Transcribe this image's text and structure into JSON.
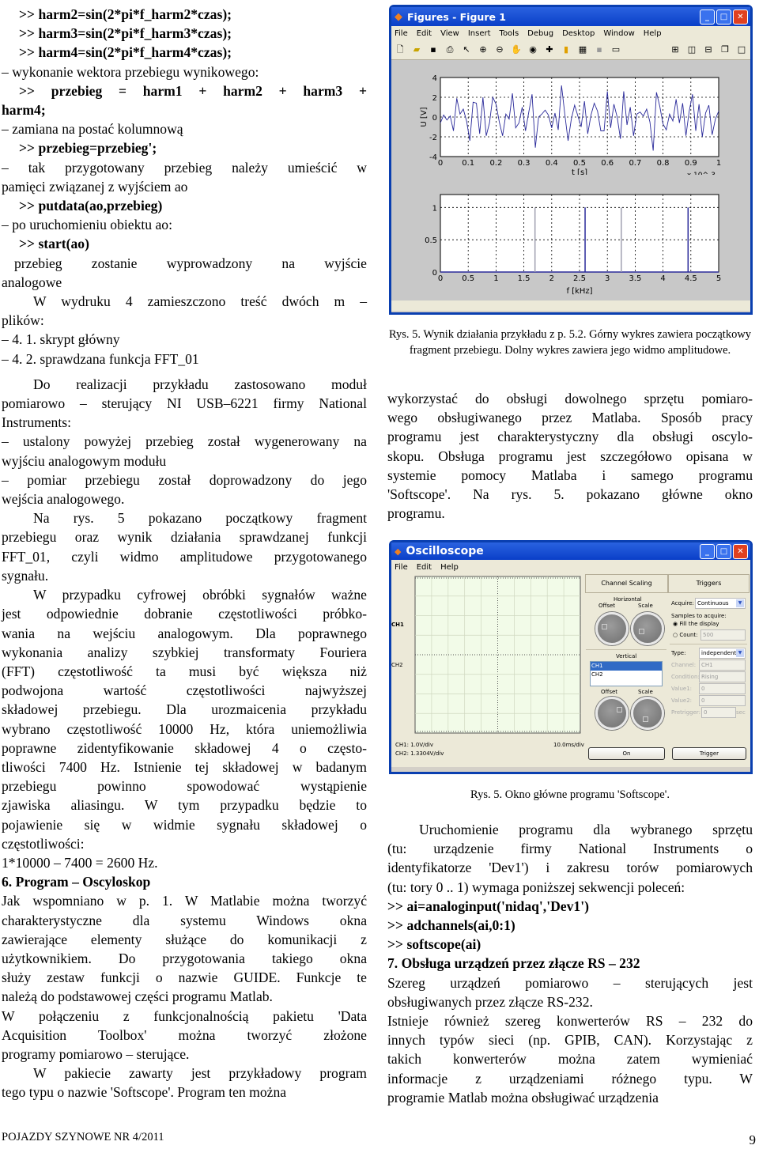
{
  "left_column": {
    "code_lines": [
      ">> harm2=sin(2*pi*f_harm2*czas);",
      ">> harm3=sin(2*pi*f_harm3*czas);",
      ">> harm4=sin(2*pi*f_harm4*czas);"
    ],
    "step_vector": "– wykonanie wektora przebiegu wynikowego:",
    "code_sum_line1": ">>  przebieg  =  harm1  +  harm2  +  harm3  +",
    "code_sum_line2": "harm4;",
    "step_column": "– zamiana na postać kolumnową",
    "code_transpose": ">> przebieg=przebieg';",
    "step_memory_1": "–  tak  przygotowany  przebieg  należy  umieścić  w",
    "step_memory_2": "pamięci związanej z wyjściem ao",
    "code_putdata": ">> putdata(ao,przebieg)",
    "step_start": "– po uruchomieniu obiektu ao:",
    "code_start": ">> start(ao)",
    "result_1": "przebieg  zostanie  wyprowadzony  na  wyjście",
    "result_2": "analogowe",
    "listing_1": "W wydruku 4 zamieszczono treść dwóch m –",
    "listing_2": "plików:",
    "listing_item_1": "– 4. 1. skrypt główny",
    "listing_item_2": "– 4. 2. sprawdzana funkcja FFT_01",
    "para_module": [
      "Do realizacji przykładu zastosowano moduł",
      "pomiarowo – sterujący NI USB–6221 firmy National",
      "Instruments:"
    ],
    "bullet_generated": [
      "– ustalony powyżej przebieg został wygenerowany na",
      "wyjściu analogowym modułu"
    ],
    "bullet_measured": [
      "–  pomiar  przebiegu  został  doprowadzony  do  jego",
      "wejścia analogowego."
    ],
    "para_rys5": [
      "Na rys. 5 pokazano początkowy fragment",
      "przebiegu oraz wynik działania sprawdzanej funkcji",
      "FFT_01, czyli widmo amplitudowe przygotowanego",
      "sygnału."
    ],
    "para_aliasing": [
      "W przypadku cyfrowej obróbki sygnałów ważne",
      "jest odpowiednie dobranie częstotliwości próbko-",
      "wania na wejściu analogowym. Dla poprawnego",
      "wykonania analizy szybkiej transformaty Fouriera",
      "(FFT) częstotliwość ta musi być większa niż",
      "podwojona wartość częstotliwości najwyższej",
      "składowej przebiegu. Dla urozmaicenia przykładu",
      "wybrano częstotliwość 10000 Hz, która uniemożliwia",
      "poprawne zidentyfikowanie składowej 4 o często-",
      "tliwości 7400 Hz. Istnienie tej składowej w badanym",
      "przebiegu powinno spowodować wystąpienie",
      "zjawiska aliasingu. W tym przypadku będzie to",
      "pojawienie się w widmie sygnału składowej o",
      "częstotliwości:"
    ],
    "formula": "1*10000 – 7400 = 2600 Hz.",
    "section_6_heading": "6. Program – Oscyloskop",
    "para_guide": [
      "Jak wspomniano w p. 1. W Matlabie można tworzyć",
      "charakterystyczne dla systemu Windows okna",
      "zawierające elementy służące do komunikacji z",
      "użytkownikiem. Do przygotowania takiego okna",
      "służy zestaw funkcji o nazwie GUIDE. Funkcje te",
      "należą do podstawowej części programu Matlab."
    ],
    "para_daq": [
      "W połączeniu z funkcjonalnością pakietu 'Data",
      "Acquisition Toolbox' można tworzyć złożone",
      "programy pomiarowo – sterujące."
    ],
    "para_softscope": [
      "W pakiecie zawarty jest przykładowy program",
      "tego typu o nazwie 'Softscope'. Program ten można"
    ]
  },
  "figure_window": {
    "title": "Figures - Figure 1",
    "menu": [
      "File",
      "Edit",
      "View",
      "Insert",
      "Tools",
      "Debug",
      "Desktop",
      "Window",
      "Help"
    ],
    "caption": "Rys. 5.  Wynik działania przykładu z  p. 5.2. Górny wykres zawiera początkowy fragment przebiegu. Dolny wykres zawiera jego widmo amplitudowe."
  },
  "chart_data": [
    {
      "type": "line",
      "title": "",
      "xlabel": "t [s]",
      "ylabel": "U [V]",
      "x_multiplier": "x 10^-3",
      "xlim": [
        0,
        1
      ],
      "ylim": [
        -4,
        4
      ],
      "xticks": [
        "0",
        "0.1",
        "0.2",
        "0.3",
        "0.4",
        "0.5",
        "0.6",
        "0.7",
        "0.8",
        "0.9",
        "1"
      ],
      "yticks": [
        "-4",
        "-2",
        "0",
        "2",
        "4"
      ],
      "grid": true,
      "color": "#2a2a9a",
      "y": [
        -0.6,
        0.2,
        -0.3,
        0.1,
        -1.4,
        1.9,
        0.3,
        0.8,
        -0.4,
        -2.4,
        1.5,
        1.4,
        -1.7,
        2.0,
        -1.9,
        -0.6,
        2.0,
        1.3,
        -0.5,
        -1.9,
        0.3,
        -0.2,
        2.4,
        -1.1,
        -0.6,
        1.0,
        -1.4,
        0.5,
        2.3,
        -3.1,
        0.0,
        0.3,
        0.7,
        0.2,
        -1.1,
        0.4,
        -1.3,
        3.2,
        0.3,
        -2.4,
        -0.2,
        1.2,
        0.1,
        -1.0,
        1.6,
        -1.7,
        0.2,
        1.4,
        0.6,
        -1.4,
        -1.4,
        2.6,
        -1.1,
        1.3,
        0.0,
        -2.2,
        2.6,
        -0.8,
        1.0,
        -1.9,
        0.3,
        0.5,
        0.1,
        0.8,
        -0.5,
        -3.4,
        2.5,
        1.1,
        -0.7,
        -1.3,
        0.3,
        -0.4,
        1.8,
        -0.6,
        1.4,
        -1.9,
        0.6,
        2.3,
        -1.4,
        1.3,
        -2.0,
        0.4,
        1.2,
        -1.8,
        -0.2,
        0.6
      ]
    },
    {
      "type": "bar",
      "title": "",
      "xlabel": "f [kHz]",
      "ylabel": "",
      "xlim": [
        0,
        5
      ],
      "ylim": [
        0,
        1.2
      ],
      "xticks": [
        "0",
        "0.5",
        "1",
        "1.5",
        "2",
        "2.5",
        "3",
        "3.5",
        "4",
        "4.5",
        "5"
      ],
      "yticks": [
        "0",
        "0.5",
        "1"
      ],
      "grid": true,
      "color": "#2a2a9a",
      "lines": [
        {
          "f": 1.7,
          "amplitude": 1.0,
          "color": "#a0a0b0"
        },
        {
          "f": 2.6,
          "amplitude": 1.0,
          "color": "#2a2a9a"
        },
        {
          "f": 3.25,
          "amplitude": 1.0,
          "color": "#a0a0b0"
        },
        {
          "f": 4.45,
          "amplitude": 1.0,
          "color": "#2a2a9a"
        }
      ]
    }
  ],
  "right_column": {
    "para_intro": [
      "wykorzystać do obsługi dowolnego sprzętu pomiaro-",
      "wego obsługiwanego przez Matlaba. Sposób pracy",
      "programu jest charakterystyczny dla obsługi oscylo-",
      "skopu. Obsługa programu jest szczegółowo opisana w",
      "systemie pomocy Matlaba i samego programu",
      "'Softscope'. Na rys. 5. pokazano główne okno",
      "programu."
    ],
    "caption_softscope": "Rys. 5.  Okno główne programu 'Softscope'.",
    "para_launch": [
      "Uruchomienie programu dla wybranego sprzętu",
      "(tu: urządzenie firmy National Instruments o",
      "identyfikatorze 'Dev1') i zakresu torów pomiarowych",
      "(tu: tory 0 .. 1) wymaga poniższej sekwencji poleceń:"
    ],
    "code_lines": [
      ">> ai=analoginput('nidaq','Dev1')",
      ">> adchannels(ai,0:1)",
      ">> softscope(ai)"
    ],
    "section_7_heading": "7. Obsługa urządzeń przez złącze RS – 232",
    "para_rs": [
      "Szereg urządzeń pomiarowo – sterujących jest",
      "obsługiwanych przez złącze RS-232."
    ],
    "para_converters": [
      "Istnieje również szereg konwerterów RS – 232 do",
      "innych typów sieci (np. GPIB, CAN). Korzystając z",
      "takich konwerterów można zatem wymieniać",
      "informacje z urządzeniami różnego typu. W",
      "programie Matlab można obsługiwać urządzenia"
    ]
  },
  "oscilloscope": {
    "title": "Oscilloscope",
    "menu": [
      "File",
      "Edit",
      "Help"
    ],
    "ch1_label": "CH1",
    "ch2_label": "CH2",
    "ch1_scale": "CH1: 1.0V/div",
    "ch2_scale": "CH2: 1.3304V/div",
    "time_scale": "10.0ms/div",
    "channel_scaling": {
      "header": "Channel Scaling",
      "horizontal": "Horizontal",
      "offset": "Offset",
      "scale": "Scale",
      "vertical": "Vertical",
      "channels": [
        "CH1",
        "CH2"
      ],
      "selected_channel": "CH1",
      "on_button": "On"
    },
    "triggers": {
      "header": "Triggers",
      "acquire_label": "Acquire:",
      "acquire_value": "Continuous",
      "samples_label": "Samples to acquire:",
      "fill_display": "Fill the display",
      "count_label": "Count:",
      "count_value": "500",
      "type_label": "Type:",
      "type_value": "independent",
      "channel_label": "Channel:",
      "channel_value": "CH1",
      "condition_label": "Condition:",
      "condition_value": "Rising",
      "value1_label": "Value1:",
      "value1": "0",
      "value2_label": "Value2:",
      "value2": "0",
      "pretrigger_label": "Pretrigger:",
      "pretrigger_value": "0",
      "pretrigger_unit": "sec",
      "trigger_button": "Trigger"
    }
  },
  "footer": {
    "journal": "POJAZDY SZYNOWE  NR  4/2011",
    "page_number": "9"
  }
}
